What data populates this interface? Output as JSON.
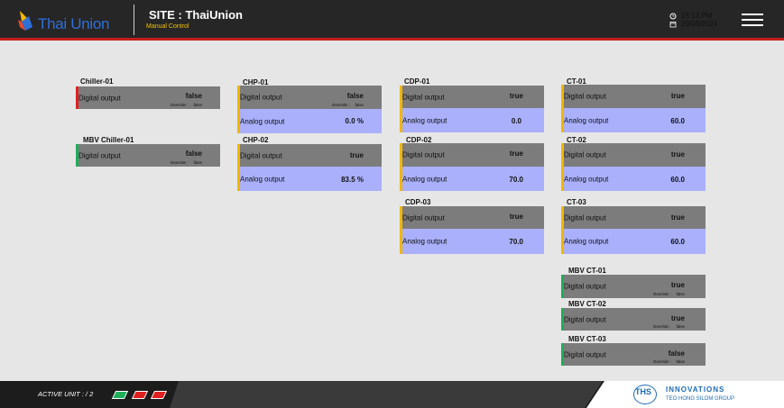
{
  "header": {
    "brand": "Thai Union",
    "site_title": "SITE : ThaiUnion",
    "subtitle": "Manual Control",
    "time": "15:13 PM",
    "date": "20/03/2024",
    "time_icon": "clock-icon",
    "date_icon": "calendar-icon",
    "menu_icon": "hamburger-icon"
  },
  "labels": {
    "digital": "Digital output",
    "analog": "Analog output",
    "override": "Override :"
  },
  "colors": {
    "alarm": "#e02020",
    "ok": "#1fae5a",
    "warn": "#f2b600",
    "digital_bg": "#7c7c7c",
    "analog_bg": "#aab0fb"
  },
  "units": {
    "chiller_01": {
      "title": "Chiller-01",
      "digital": "false",
      "override": "false"
    },
    "mbv_chiller_01": {
      "title": "MBV Chiller-01",
      "digital": "false",
      "override": "false"
    },
    "chp_01": {
      "title": "CHP-01",
      "digital": "false",
      "override": "false",
      "analog": "0.0 %"
    },
    "chp_02": {
      "title": "CHP-02",
      "digital": "true",
      "analog": "83.5 %"
    },
    "cdp_01": {
      "title": "CDP-01",
      "digital": "true",
      "analog": "0.0"
    },
    "cdp_02": {
      "title": "CDP-02",
      "digital": "true",
      "analog": "70.0"
    },
    "cdp_03": {
      "title": "CDP-03",
      "digital": "true",
      "analog": "70.0"
    },
    "ct_01": {
      "title": "CT-01",
      "digital": "true",
      "analog": "60.0"
    },
    "ct_02": {
      "title": "CT-02",
      "digital": "true",
      "analog": "60.0"
    },
    "ct_03": {
      "title": "CT-03",
      "digital": "true",
      "analog": "60.0"
    },
    "mbv_ct_01": {
      "title": "MBV CT-01",
      "digital": "true",
      "override": "false"
    },
    "mbv_ct_02": {
      "title": "MBV CT-02",
      "digital": "true",
      "override": "false"
    },
    "mbv_ct_03": {
      "title": "MBV CT-03",
      "digital": "false",
      "override": "false"
    }
  },
  "footer": {
    "active_unit": "ACTIVE UNIT : / 2",
    "ths_mark": "THS",
    "company_1": "INNOVATIONS",
    "company_2": "TEO HONG SILOM GROUP"
  }
}
